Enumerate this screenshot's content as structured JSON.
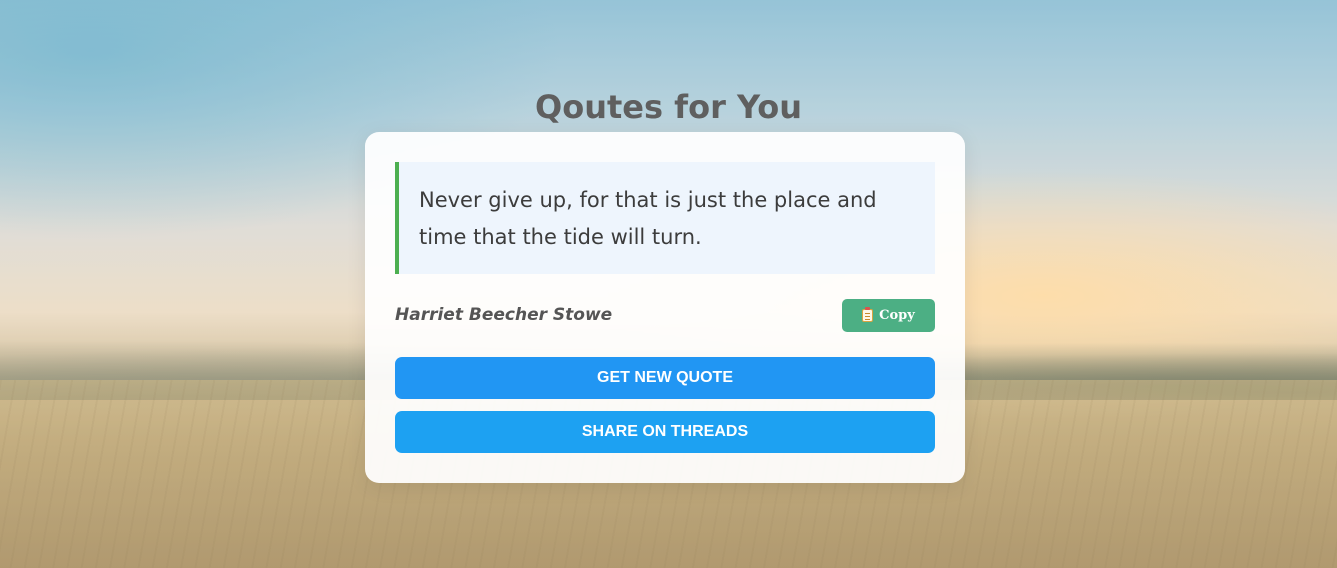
{
  "page": {
    "title": "Qoutes for You"
  },
  "quote": {
    "text": "Never give up, for that is just the place and time that the tide will turn.",
    "author": "Harriet Beecher Stowe"
  },
  "actions": {
    "copy_icon": "clipboard-icon",
    "copy_label": "Copy",
    "new_quote_label": "GET NEW QUOTE",
    "share_label": "SHARE ON THREADS"
  },
  "colors": {
    "accent_border": "#4caf50",
    "copy_button": "#4caf84",
    "primary_button": "#2196f3",
    "share_button": "#1da1f2"
  }
}
